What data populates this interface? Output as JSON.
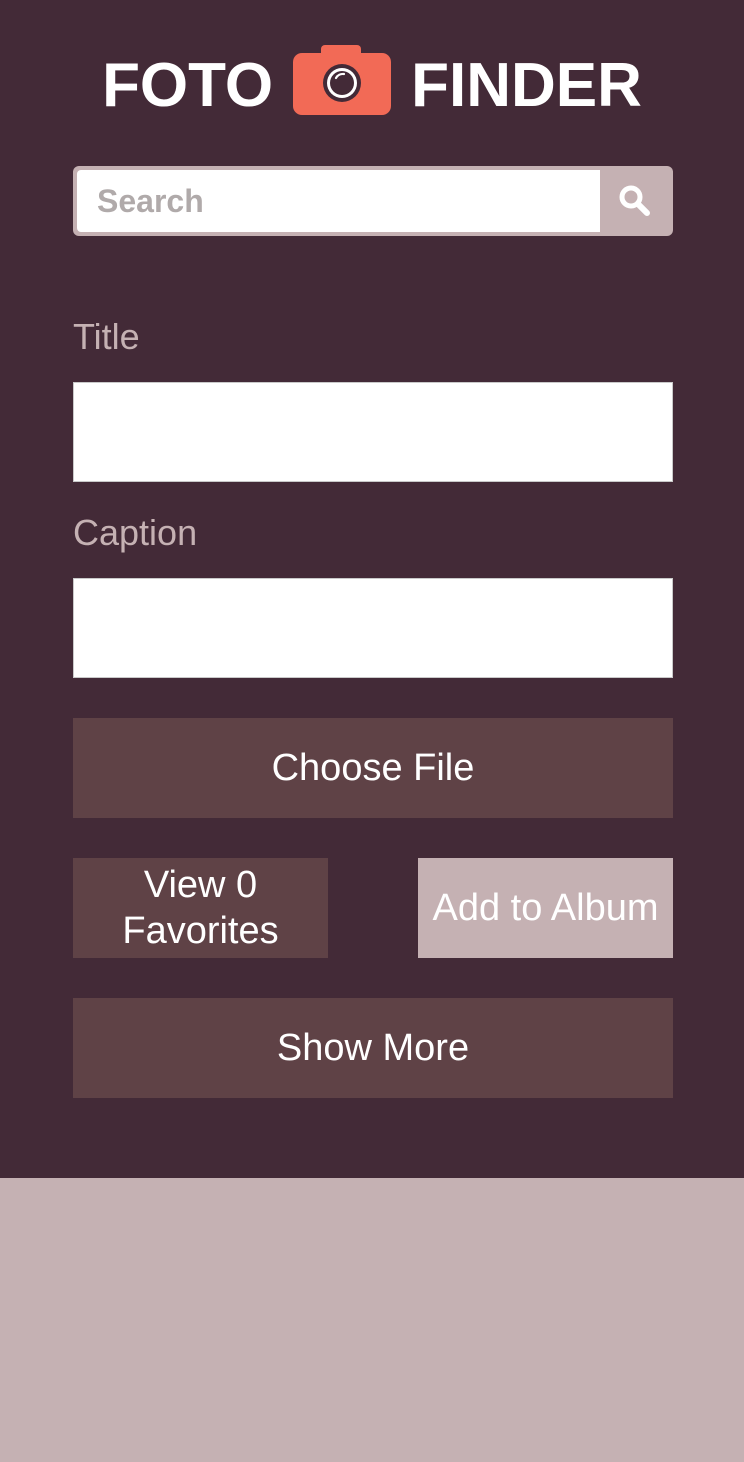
{
  "brand": {
    "word_left": "FOTO",
    "word_right": "FINDER",
    "icon": "camera-icon",
    "icon_color": "#f26a56"
  },
  "search": {
    "placeholder": "Search",
    "value": "",
    "icon": "search-icon"
  },
  "form": {
    "title_label": "Title",
    "title_value": "",
    "caption_label": "Caption",
    "caption_value": "",
    "choose_file_label": "Choose File"
  },
  "actions": {
    "view_favorites_line1": "View 0",
    "view_favorites_line2": "Favorites",
    "add_to_album_label": "Add to Album",
    "show_more_label": "Show More"
  },
  "colors": {
    "header_bg": "#432a37",
    "button_dark": "#5f4246",
    "button_light": "#c5b1b3",
    "accent": "#f26a56"
  }
}
